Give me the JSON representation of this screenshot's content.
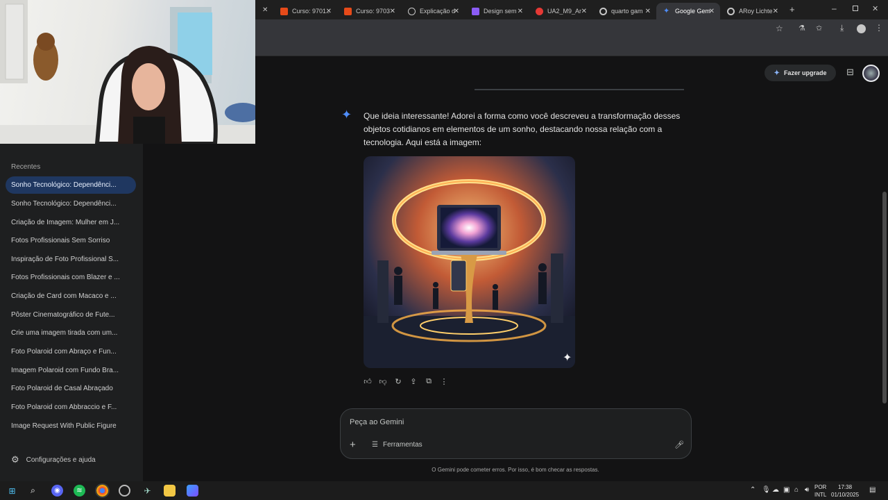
{
  "browser": {
    "tabs": [
      {
        "label": "Curso: 9701..",
        "icon": "curso-icon",
        "color": "#e64a19"
      },
      {
        "label": "Curso: 9703",
        "icon": "curso-icon",
        "color": "#e64a19"
      },
      {
        "label": "Explicação d",
        "icon": "explain-icon",
        "color": "#c7c7c7"
      },
      {
        "label": "Design sem",
        "icon": "design-icon",
        "color": "#8b5cf6"
      },
      {
        "label": "UA2_M9_Ar",
        "icon": "pdf-icon",
        "color": "#e53935"
      },
      {
        "label": "quarto gam",
        "icon": "google-icon",
        "color": "#c7c7c7"
      },
      {
        "label": "Google Gem",
        "icon": "gemini-icon",
        "color": "#4f8df9"
      },
      {
        "label": "ARoy Lichte",
        "icon": "google-icon",
        "color": "#c7c7c7"
      }
    ]
  },
  "sidebar": {
    "recent_title": "Recentes",
    "items": [
      "Sonho Tecnológico: Dependênci...",
      "Sonho Tecnológico: Dependênci...",
      "Criação de Imagem: Mulher em J...",
      "Fotos Profissionais Sem Sorriso",
      "Inspiração de Foto Profissional S...",
      "Fotos Profissionais com Blazer e ...",
      "Criação de Card com Macaco e ...",
      "Pôster Cinematográfico de Fute...",
      "Crie uma imagem tirada com um...",
      "Foto Polaroid com Abraço e Fun...",
      "Imagem Polaroid com Fundo Bra...",
      "Foto Polaroid de Casal Abraçado",
      "Foto Polaroid com Abbraccio e F...",
      "Image Request With Public Figure"
    ],
    "settings_label": "Configurações e ajuda"
  },
  "header": {
    "upgrade_label": "Fazer upgrade"
  },
  "chat": {
    "response_text": "Que ideia interessante! Adorei a forma como você descreveu a transformação desses objetos cotidianos em elementos de um sonho, destacando nossa relação com a tecnologia. Aqui está a imagem:",
    "input_placeholder": "Peça ao Gemini",
    "tools_label": "Ferramentas",
    "disclaimer": "O Gemini pode cometer erros. Por isso, é bom checar as respostas."
  },
  "taskbar": {
    "lang_top": "POR",
    "lang_bottom": "INTL",
    "time": "17:38",
    "date": "01/10/2025"
  }
}
